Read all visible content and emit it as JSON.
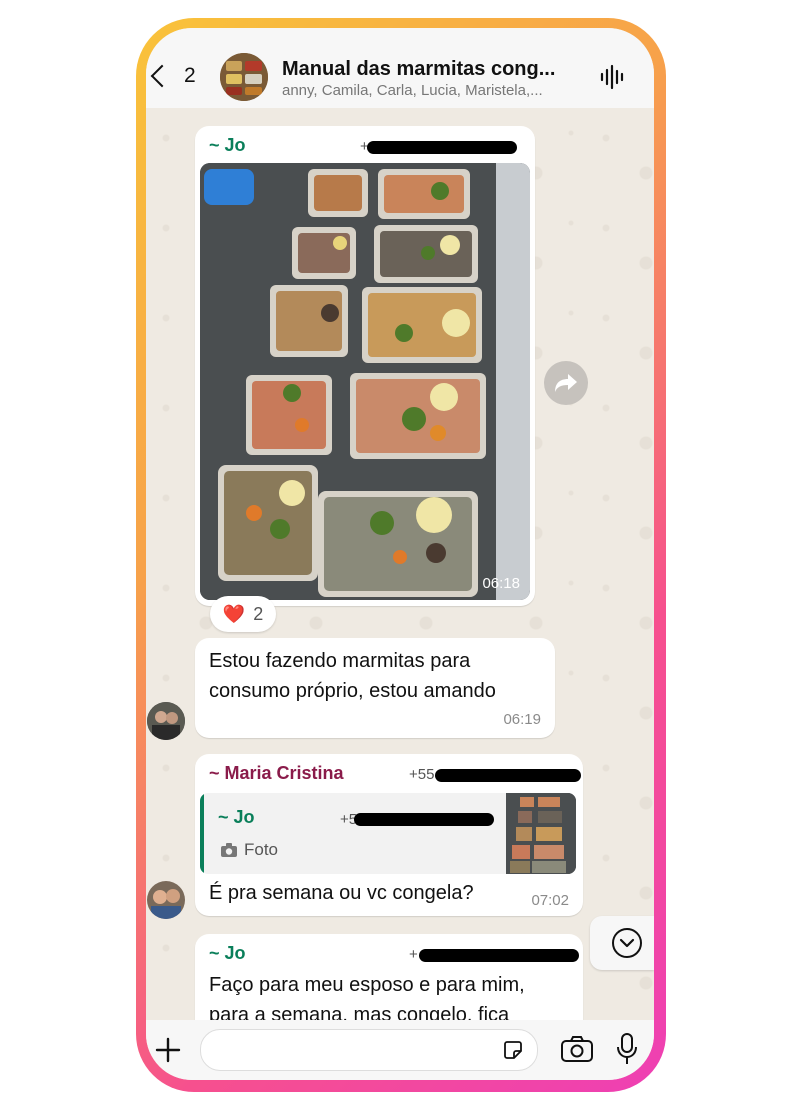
{
  "header": {
    "back_count": "2",
    "group_title": "Manual das marmitas cong...",
    "group_members": "anny, Camila, Carla, Lucia, Maristela,..."
  },
  "messages": [
    {
      "sender": "~ Jo",
      "phone_prefix": "+",
      "photo_time": "06:18",
      "reaction_emoji": "❤️",
      "reaction_count": "2"
    },
    {
      "text_line1": "Estou fazendo marmitas para",
      "text_line2": "consumo próprio, estou amando",
      "time": "06:19"
    },
    {
      "sender": "~ Maria Cristina",
      "phone_prefix": "+55",
      "quote_sender": "~ Jo",
      "quote_phone_prefix": "+5",
      "quote_type": "Foto",
      "text": "É pra semana ou vc congela?",
      "time": "07:02"
    },
    {
      "sender": "~ Jo",
      "phone_prefix": "+",
      "text_line1": "Faço para meu esposo e para mim,",
      "text_line2": "para a semana, mas congelo, fica"
    }
  ],
  "icons": {
    "back": "chevron-left-icon",
    "voice_chat": "waveform-icon",
    "forward": "forward-icon",
    "scroll_down": "chevron-down-circle-icon",
    "attach": "plus-icon",
    "sticker": "sticker-icon",
    "camera": "camera-icon",
    "mic": "microphone-icon"
  },
  "colors": {
    "sender_green": "#0a7f5a",
    "sender_maroon": "#8a1b4a",
    "frame_start": "#f9c33a",
    "frame_end": "#ee3fb4"
  }
}
